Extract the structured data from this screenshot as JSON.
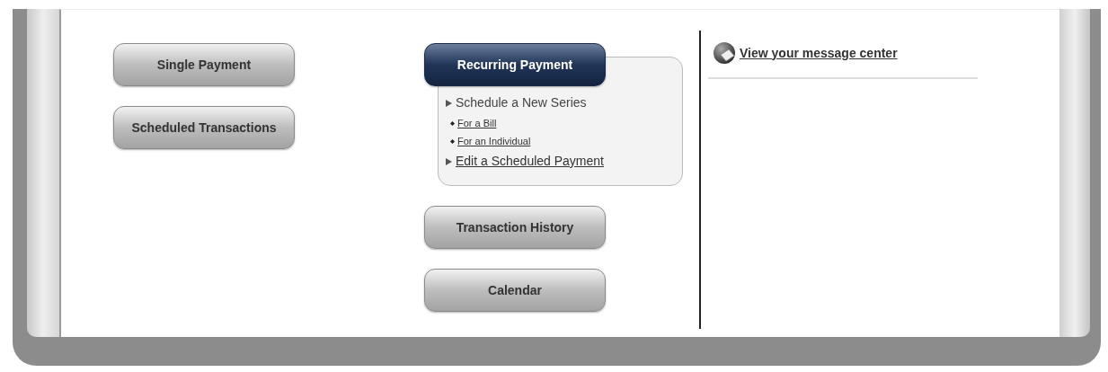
{
  "left_buttons": [
    {
      "label": "Single Payment",
      "selected": false
    },
    {
      "label": "Scheduled Transactions",
      "selected": false
    }
  ],
  "middle_buttons": [
    {
      "label": "Recurring Payment",
      "selected": true,
      "menu": [
        {
          "kind": "heading",
          "text": "Schedule a New Series",
          "children": [
            {
              "text": "For a Bill"
            },
            {
              "text": "For an Individual"
            }
          ]
        },
        {
          "kind": "link",
          "text": "Edit a Scheduled Payment"
        }
      ]
    },
    {
      "label": "Transaction History",
      "selected": false
    },
    {
      "label": "Calendar",
      "selected": false
    }
  ],
  "message_link": "View your message center"
}
